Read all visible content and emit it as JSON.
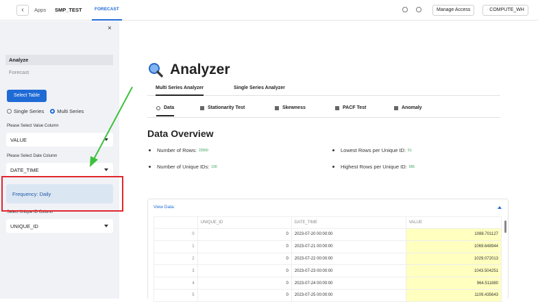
{
  "topbar": {
    "back_icon": "chevron-left-icon",
    "apps_label": "Apps",
    "app_name": "SMP_TEST",
    "active_tab": "FORECAST",
    "manage_access": "Manage Access",
    "warehouse": "COMPUTE_WH"
  },
  "sidebar": {
    "close": "×",
    "nav": [
      {
        "label": "Analyze"
      },
      {
        "label": "Forecast"
      }
    ],
    "select_table": "Select Table",
    "radio_single": "Single Series",
    "radio_multi": "Multi Series",
    "value_col_label": "Please Select Value Column",
    "value_col": "VALUE",
    "date_col_label": "Please Select Date Column",
    "date_col": "DATE_TIME",
    "frequency": "Frequency: Daily",
    "uid_col_label": "Select Unique ID Column",
    "uid_col": "UNIQUE_ID"
  },
  "main": {
    "title": "Analyzer",
    "tabs": [
      "Multi Series Analyzer",
      "Single Series Analyzer"
    ],
    "subtabs": [
      "Data",
      "Stationarity Test",
      "Skewness",
      "PACF Test",
      "Anomaly"
    ],
    "section_title": "Data Overview",
    "stats": {
      "rows_label": "Number of Rows:",
      "rows_value": "22500",
      "uids_label": "Number of Unique IDs:",
      "uids_value": "100",
      "lowest_label": "Lowest Rows per Unique ID:",
      "lowest_value": "51",
      "highest_label": "Highest Rows per Unique ID:",
      "highest_value": "565"
    },
    "view_data": "View Data:",
    "table": {
      "headers": [
        "",
        "UNIQUE_ID",
        "DATE_TIME",
        "VALUE"
      ],
      "rows": [
        [
          "0",
          "0",
          "2023-07-20 00:00:00",
          "1088.701127"
        ],
        [
          "1",
          "0",
          "2023-07-21 00:00:00",
          "1069.648944"
        ],
        [
          "2",
          "0",
          "2023-07-22 00:00:00",
          "1029.072013"
        ],
        [
          "3",
          "0",
          "2023-07-23 00:00:00",
          "1043.504251"
        ],
        [
          "4",
          "0",
          "2023-07-24 00:00:00",
          "964.511880"
        ],
        [
          "5",
          "0",
          "2023-07-25 00:00:00",
          "1109.435643"
        ]
      ]
    }
  },
  "colors": {
    "accent": "#1f6bd6",
    "annotation_red": "#e0242b",
    "annotation_green": "#3cc13b",
    "highlight_yellow": "#ffffc0"
  }
}
